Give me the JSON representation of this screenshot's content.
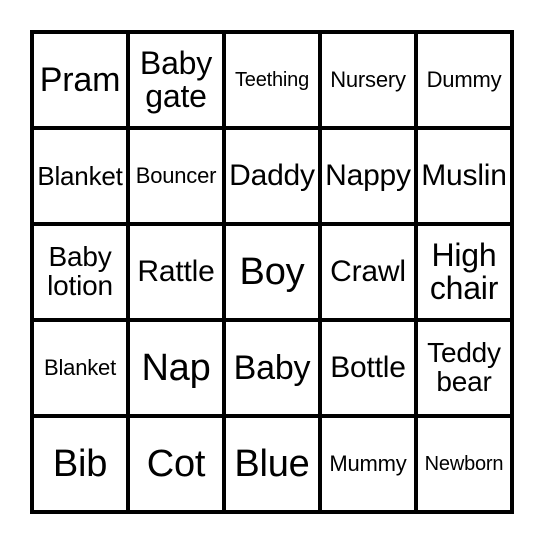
{
  "card": {
    "type": "bingo-card",
    "theme": "Baby shower bingo",
    "grid": {
      "rows": 5,
      "columns": 5
    },
    "colors": {
      "background": "#ffffff",
      "cell_background": "#ffffff",
      "border": "#000000",
      "text": "#000000"
    },
    "rows": [
      [
        {
          "label": "Pram",
          "lines": "Pram",
          "size": "fs-xxl"
        },
        {
          "label": "Baby gate",
          "lines": "Baby\ngate",
          "size": "fs-xl"
        },
        {
          "label": "Teething",
          "lines": "Teething",
          "size": "fs-xs"
        },
        {
          "label": "Nursery",
          "lines": "Nursery",
          "size": "fs-s"
        },
        {
          "label": "Dummy",
          "lines": "Dummy",
          "size": "fs-s"
        }
      ],
      [
        {
          "label": "Blanket",
          "lines": "Blanket",
          "size": "fs-m"
        },
        {
          "label": "Bouncer",
          "lines": "Bouncer",
          "size": "fs-s"
        },
        {
          "label": "Daddy",
          "lines": "Daddy",
          "size": "fs-l"
        },
        {
          "label": "Nappy",
          "lines": "Nappy",
          "size": "fs-l"
        },
        {
          "label": "Muslin",
          "lines": "Muslin",
          "size": "fs-l"
        }
      ],
      [
        {
          "label": "Baby lotion",
          "lines": "Baby\nlotion",
          "size": "fs-ml"
        },
        {
          "label": "Rattle",
          "lines": "Rattle",
          "size": "fs-l"
        },
        {
          "label": "Boy",
          "lines": "Boy",
          "size": "fs-3xl"
        },
        {
          "label": "Crawl",
          "lines": "Crawl",
          "size": "fs-l"
        },
        {
          "label": "High chair",
          "lines": "High\nchair",
          "size": "fs-xl"
        }
      ],
      [
        {
          "label": "Blanket",
          "lines": "Blanket",
          "size": "fs-s"
        },
        {
          "label": "Nap",
          "lines": "Nap",
          "size": "fs-3xl"
        },
        {
          "label": "Baby",
          "lines": "Baby",
          "size": "fs-xxl"
        },
        {
          "label": "Bottle",
          "lines": "Bottle",
          "size": "fs-l"
        },
        {
          "label": "Teddy bear",
          "lines": "Teddy\nbear",
          "size": "fs-ml"
        }
      ],
      [
        {
          "label": "Bib",
          "lines": "Bib",
          "size": "fs-3xl"
        },
        {
          "label": "Cot",
          "lines": "Cot",
          "size": "fs-3xl"
        },
        {
          "label": "Blue",
          "lines": "Blue",
          "size": "fs-3xl"
        },
        {
          "label": "Mummy",
          "lines": "Mummy",
          "size": "fs-s"
        },
        {
          "label": "Newborn",
          "lines": "Newborn",
          "size": "fs-xs"
        }
      ]
    ]
  }
}
